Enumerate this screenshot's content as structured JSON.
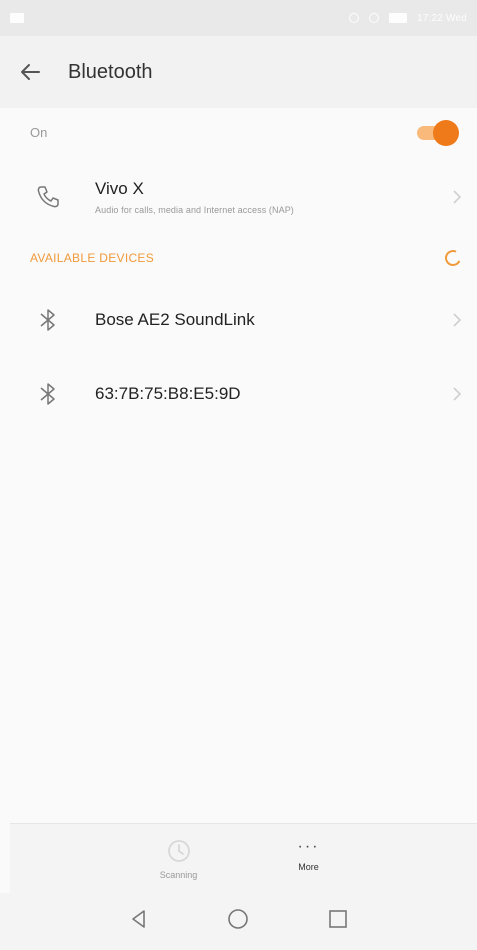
{
  "status_bar": {
    "time": "17:22 Wed"
  },
  "header": {
    "title": "Bluetooth"
  },
  "bluetooth_toggle": {
    "label": "On",
    "state": "on",
    "accent": "#ef7a1a"
  },
  "paired_devices": [
    {
      "name": "Vivo X",
      "subtitle": "Audio for calls, media and Internet access (NAP)",
      "icon": "phone-icon"
    }
  ],
  "available_devices": {
    "header": "AVAILABLE DEVICES",
    "items": [
      {
        "name": "Bose AE2 SoundLink",
        "icon": "bluetooth-icon"
      },
      {
        "name": "63:7B:75:B8:E5:9D",
        "icon": "bluetooth-icon"
      }
    ]
  },
  "bottom_bar": {
    "refresh_label": "Scanning",
    "more_label": "More"
  },
  "nav": {
    "back": "back-triangle-icon",
    "home": "home-circle-icon",
    "recents": "recents-square-icon"
  },
  "colors": {
    "accent": "#f09a3b",
    "toggle_knob": "#ef7a1a"
  }
}
